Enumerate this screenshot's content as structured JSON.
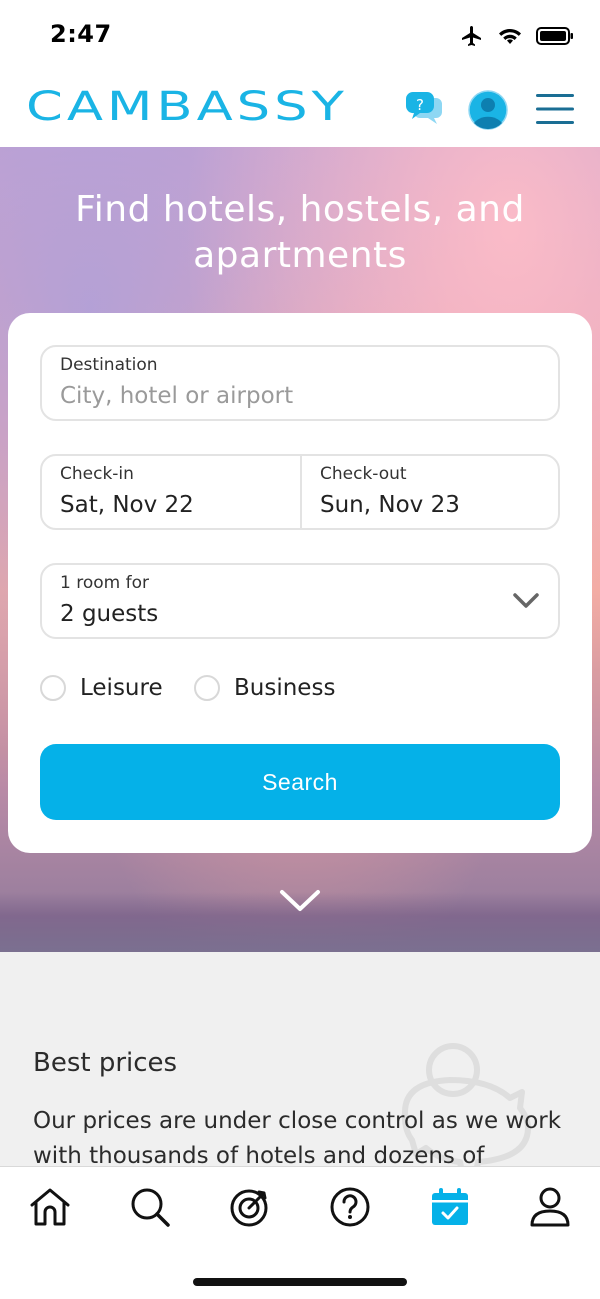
{
  "status_bar": {
    "time": "2:47"
  },
  "header": {
    "logo": "CAMBASSY",
    "chat_icon_text": "?"
  },
  "hero": {
    "title": "Find hotels, hostels, and apartments"
  },
  "search_form": {
    "destination": {
      "label": "Destination",
      "placeholder": "City, hotel or airport"
    },
    "checkin": {
      "label": "Check-in",
      "value": "Sat, Nov 22"
    },
    "checkout": {
      "label": "Check-out",
      "value": "Sun, Nov 23"
    },
    "guests": {
      "label": "1 room for",
      "value": "2 guests"
    },
    "trip_types": [
      "Leisure",
      "Business"
    ],
    "search_label": "Search"
  },
  "content": {
    "title": "Best prices",
    "text": "Our prices are under close control as we work with thousands of hotels and dozens of"
  },
  "tabs": [
    "home-icon",
    "search-icon",
    "target-icon",
    "help-icon",
    "calendar-icon",
    "profile-icon"
  ],
  "colors": {
    "accent": "#05b1e8",
    "logo": "#1ab4e5"
  }
}
